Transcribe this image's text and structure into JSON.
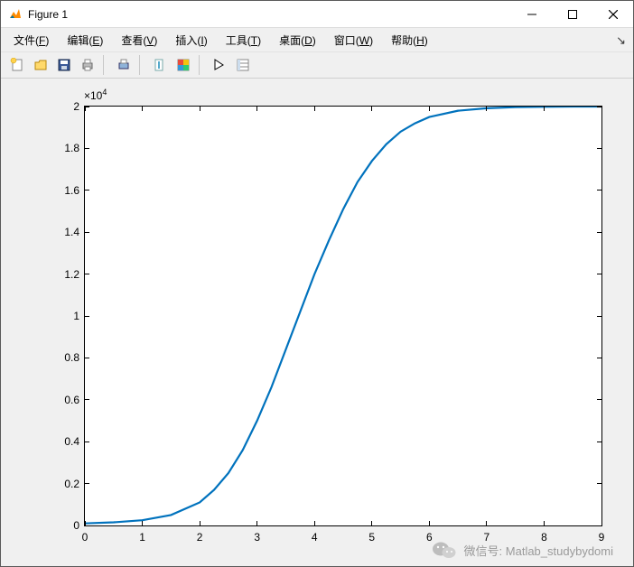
{
  "window": {
    "title": "Figure 1"
  },
  "menubar": {
    "file": "文件(",
    "file_u": "F",
    "file2": ")",
    "edit": "编辑(",
    "edit_u": "E",
    "edit2": ")",
    "view": "查看(",
    "view_u": "V",
    "view2": ")",
    "insert": "插入(",
    "insert_u": "I",
    "insert2": ")",
    "tools": "工具(",
    "tools_u": "T",
    "tools2": ")",
    "desktop": "桌面(",
    "desktop_u": "D",
    "desktop2": ")",
    "window_m": "窗口(",
    "window_u": "W",
    "window2": ")",
    "help": "帮助(",
    "help_u": "H",
    "help2": ")"
  },
  "axis": {
    "multiplier_prefix": "×10",
    "multiplier_exp": "4",
    "yticks": [
      "0",
      "0.2",
      "0.4",
      "0.6",
      "0.8",
      "1",
      "1.2",
      "1.4",
      "1.6",
      "1.8",
      "2"
    ],
    "xticks": [
      "0",
      "1",
      "2",
      "3",
      "4",
      "5",
      "6",
      "7",
      "8",
      "9"
    ]
  },
  "watermark": {
    "text": "微信号: Matlab_studybydomi"
  },
  "chart_data": {
    "type": "line",
    "title": "",
    "xlabel": "",
    "ylabel": "",
    "xlim": [
      0,
      9
    ],
    "ylim": [
      0,
      20000
    ],
    "y_axis_multiplier": "×10^4",
    "series_color": "#0072bd",
    "x": [
      0,
      0.5,
      1,
      1.5,
      2,
      2.25,
      2.5,
      2.75,
      3,
      3.25,
      3.5,
      3.75,
      4,
      4.25,
      4.5,
      4.75,
      5,
      5.25,
      5.5,
      5.75,
      6,
      6.5,
      7,
      7.5,
      8,
      8.5,
      9
    ],
    "y": [
      100,
      150,
      250,
      500,
      1100,
      1700,
      2500,
      3600,
      5000,
      6600,
      8400,
      10200,
      12000,
      13600,
      15100,
      16400,
      17400,
      18200,
      18800,
      19200,
      19500,
      19800,
      19920,
      19970,
      19990,
      19998,
      20000
    ]
  }
}
